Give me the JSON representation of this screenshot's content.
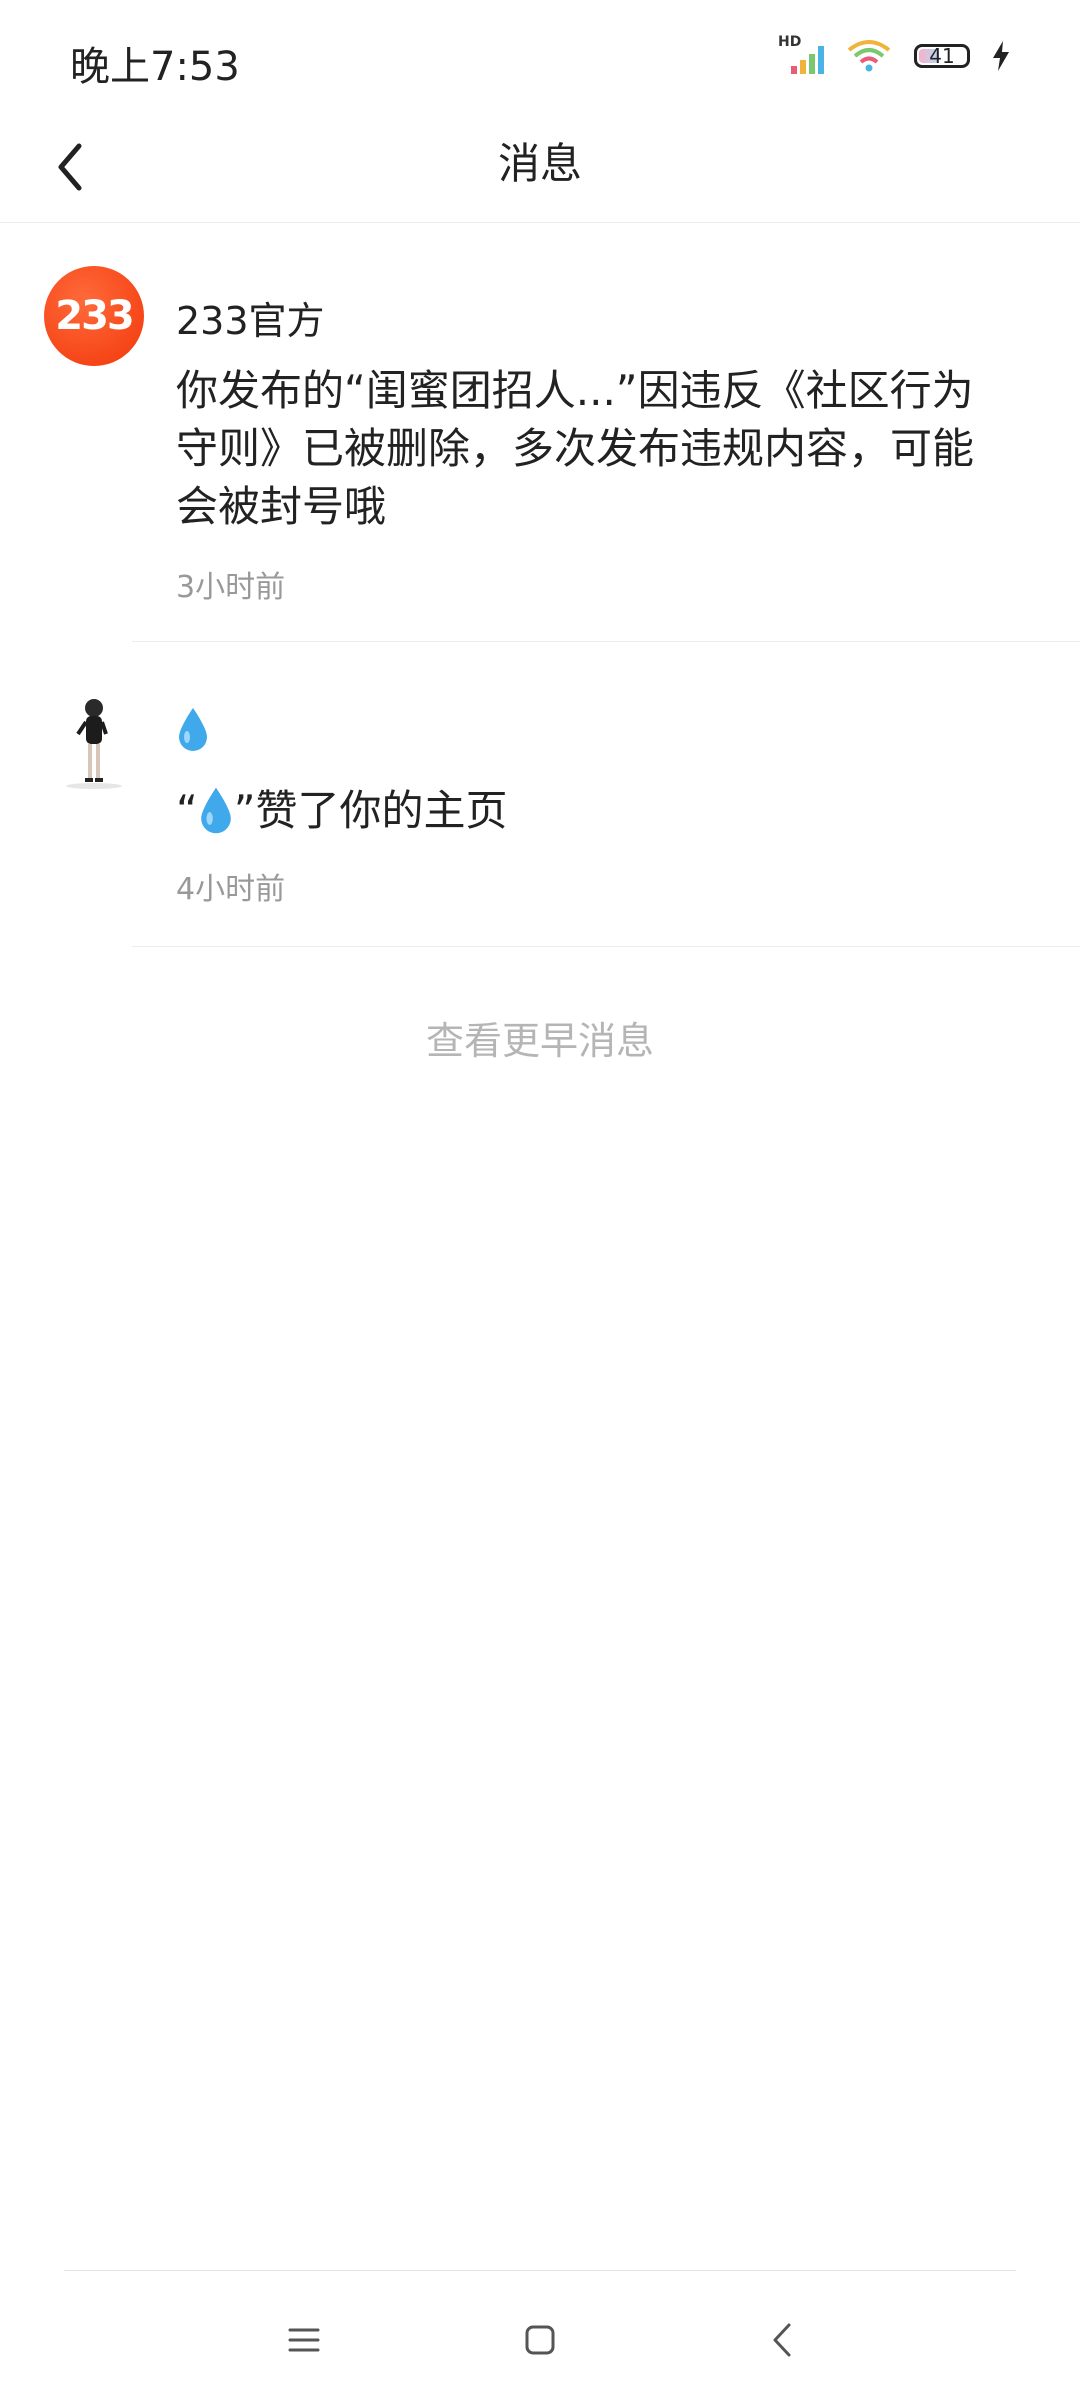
{
  "status_bar": {
    "time": "晚上7:53",
    "battery_level": "41",
    "network_label": "HD"
  },
  "header": {
    "title": "消息"
  },
  "messages": [
    {
      "avatar_text": "233",
      "sender": "233官方",
      "body": "你发布的“闺蜜团招人...”因违反《社区行为守则》已被删除，多次发布违规内容，可能会被封号哦",
      "time": "3小时前"
    },
    {
      "body_open": "“",
      "body_close": "”赞了你的主页",
      "time": "4小时前"
    }
  ],
  "load_more": "查看更早消息"
}
